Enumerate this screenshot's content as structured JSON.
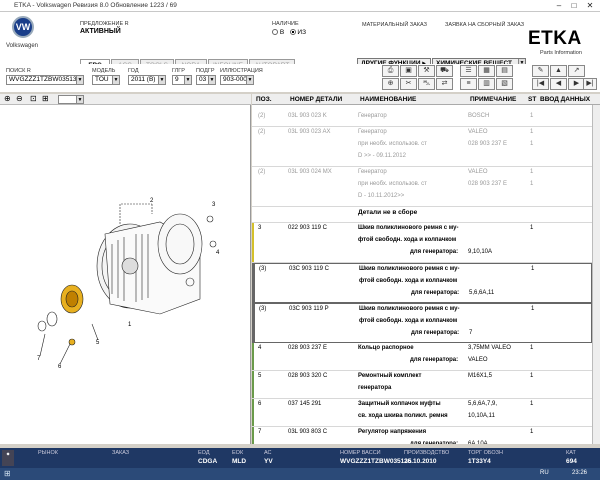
{
  "window": {
    "title": "ETKA - Volkswagen Ревизия 8.0 Обновление 1223 / 69"
  },
  "brand": {
    "vw_label": "Volkswagen",
    "etka": "ETKA",
    "etka_sub": "Parts Information"
  },
  "header": {
    "offer_label": "ПРЕДЛОЖЕНИЕ R",
    "offer_value": "АКТИВНЫЙ",
    "availability_label": "НАЛИЧИЕ",
    "opt_b": "В",
    "opt_iz": "ИЗ",
    "material_order": "МАТЕРИАЛЬНЫЙ ЗАКАЗ",
    "assembly_order": "ЗАЯВКА НА СБОРНЫЙ ЗАКАЗ",
    "other_functions": "ДРУГИЕ ФУНКЦИИ ▸",
    "chem_substances": "ХИМИЧЕСКИЕ ВЕЩЕСТ"
  },
  "tabs": [
    "EPC",
    "ACC",
    "TOOLS",
    "NORA",
    "INFOLINE",
    "AUTOPART"
  ],
  "filters": [
    {
      "label": "ПОИСК R",
      "value": "WVGZZZ1TZBW03513"
    },
    {
      "label": "МОДЕЛЬ",
      "value": "TOU"
    },
    {
      "label": "ГОД",
      "value": "2011 (B)"
    },
    {
      "label": "ГЛГР",
      "value": "9"
    },
    {
      "label": "ПОДГР",
      "value": "03"
    },
    {
      "label": "ИЛЛЮСТРАЦИЯ",
      "value": "903-000"
    }
  ],
  "columns": [
    "ПОЗ.",
    "НОМЕР ДЕТАЛИ",
    "НАИМЕНОВАНИЕ",
    "ПРИМЕЧАНИЕ",
    "ST",
    "ВВОД ДАННЫХ"
  ],
  "rows": [
    {
      "pos": "(2)",
      "part": "03L 903 023 K",
      "name": "Генератор",
      "note": "BOSCH",
      "st": "1",
      "dim": true
    },
    {
      "pos": "(2)",
      "part": "03L 903 023 AX",
      "name": "Генератор",
      "note": "VALEO",
      "st": "1",
      "dim": true
    },
    {
      "pos": "",
      "part": "",
      "name": "при необх. использов. ст",
      "note": "028 903 237 E",
      "st": "1",
      "dim": true
    },
    {
      "pos": "",
      "part": "",
      "name": "D        >> - 09.11.2012",
      "note": "",
      "st": "",
      "dim": true
    },
    {
      "pos": "(2)",
      "part": "03L 903 024 MX",
      "name": "Генератор",
      "note": "VALEO",
      "st": "1",
      "dim": true
    },
    {
      "pos": "",
      "part": "",
      "name": "при необх. использов. ст",
      "note": "028 903 237 E",
      "st": "1",
      "dim": true
    },
    {
      "pos": "",
      "part": "",
      "name": "D - 10.11.2012>>",
      "note": "",
      "st": "",
      "dim": true
    },
    {
      "pos": "",
      "part": "",
      "name": "Детали не в сборе",
      "note": "",
      "st": "",
      "dim": false
    },
    {
      "pos": "3",
      "part": "022 903 119 C",
      "name": "Шкив поликлинового ремня с му-",
      "note": "",
      "st": "1",
      "dim": false
    },
    {
      "pos": "",
      "part": "",
      "name": "фтой свободн. хода и колпачком",
      "note": "",
      "st": "",
      "dim": false
    },
    {
      "pos": "",
      "part": "",
      "name": "для генератора:",
      "note": "9,10,10A",
      "st": "",
      "dim": false
    },
    {
      "pos": "(3)",
      "part": "03C 903 119 C",
      "name": "Шкив поликлинового ремня с му-",
      "note": "",
      "st": "1",
      "dim": false
    },
    {
      "pos": "",
      "part": "",
      "name": "фтой свободн. хода и колпачком",
      "note": "",
      "st": "",
      "dim": false
    },
    {
      "pos": "",
      "part": "",
      "name": "для генератора:",
      "note": "5,6,6A,11",
      "st": "",
      "dim": false
    },
    {
      "pos": "(3)",
      "part": "03C 903 119 P",
      "name": "Шкив поликлинового ремня с му-",
      "note": "",
      "st": "1",
      "dim": false
    },
    {
      "pos": "",
      "part": "",
      "name": "фтой свободн. хода и колпачком",
      "note": "",
      "st": "",
      "dim": false
    },
    {
      "pos": "",
      "part": "",
      "name": "для генератора:",
      "note": "7",
      "st": "",
      "dim": false
    },
    {
      "pos": "4",
      "part": "028 903 237 E",
      "name": "Кольцо распорное",
      "note": "3,75MM   VALEO",
      "st": "1",
      "dim": false
    },
    {
      "pos": "",
      "part": "",
      "name": "для генератора:",
      "note": "VALEO",
      "st": "",
      "dim": false
    },
    {
      "pos": "5",
      "part": "028 903 320 C",
      "name": "Ремонтный комплект",
      "note": "M16X1,5",
      "st": "1",
      "dim": false
    },
    {
      "pos": "",
      "part": "",
      "name": "генератора",
      "note": "",
      "st": "",
      "dim": false
    },
    {
      "pos": "6",
      "part": "037 145 291",
      "name": "Защитный колпачок муфты",
      "note": "5,6,6A,7,9,",
      "st": "1",
      "dim": false
    },
    {
      "pos": "",
      "part": "",
      "name": "св. хода шкива поликл. ремня",
      "note": "10,10A,11",
      "st": "",
      "dim": false
    },
    {
      "pos": "7",
      "part": "03L 903 803 C",
      "name": "Регулятор напряжения",
      "note": "",
      "st": "1",
      "dim": false
    },
    {
      "pos": "",
      "part": "",
      "name": "для генератора:",
      "note": "6A,10A",
      "st": "",
      "dim": false
    },
    {
      "pos": "(7)",
      "part": "07K 903 803",
      "name": "Регулятор напряжения",
      "note": "BOSCH",
      "st": "1",
      "dim": false
    },
    {
      "pos": "",
      "part": "",
      "name": "для генератора:",
      "note": "5,7,9",
      "st": "",
      "dim": false
    }
  ],
  "status": [
    {
      "label": "РЫНОК",
      "value": ""
    },
    {
      "label": "ЗАКАЗ",
      "value": ""
    },
    {
      "label": "ЕОД",
      "value": "CDGA"
    },
    {
      "label": "ЕОК",
      "value": "MLD"
    },
    {
      "label": "АС",
      "value": "YV"
    },
    {
      "label": "НОМЕР ВАССИ",
      "value": "WVGZZZ1TZBW035135"
    },
    {
      "label": "ПРОИЗВОДСТВО",
      "value": "26.10.2010"
    },
    {
      "label": "ТОРГ ОБОЗН",
      "value": "1T33Y4"
    },
    {
      "label": "КАТ",
      "value": "694"
    }
  ],
  "taskbar": {
    "lang": "RU",
    "time": "23:26"
  }
}
